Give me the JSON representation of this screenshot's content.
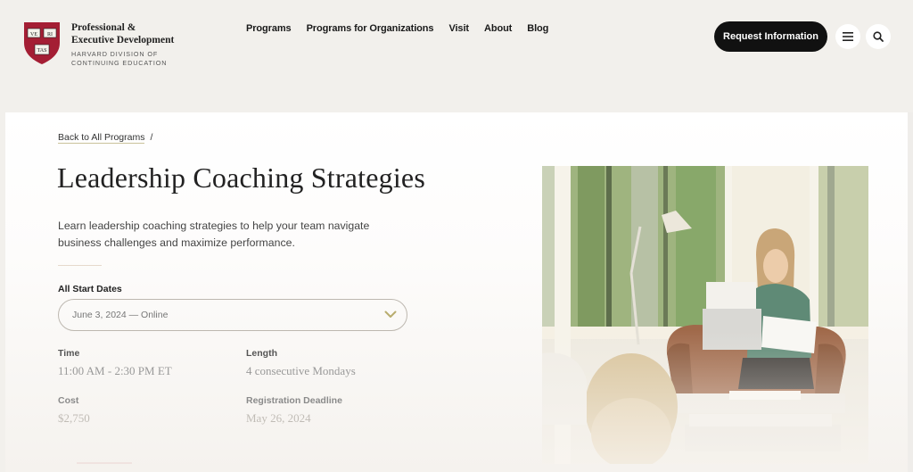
{
  "header": {
    "logo": {
      "title_line1": "Professional &",
      "title_line2": "Executive Development",
      "sub_line1": "HARVARD DIVISION OF",
      "sub_line2": "CONTINUING EDUCATION",
      "shield_color": "#a41e34",
      "shield_words": [
        "VE",
        "RI",
        "TAS"
      ]
    },
    "nav": [
      {
        "label": "Programs"
      },
      {
        "label": "Programs for Organizations"
      },
      {
        "label": "Visit"
      },
      {
        "label": "About"
      },
      {
        "label": "Blog"
      }
    ],
    "cta_label": "Request Information",
    "menu_icon": "hamburger-menu-icon",
    "search_icon": "search-icon"
  },
  "breadcrumb": {
    "back_label": "Back to All Programs",
    "separator": "/"
  },
  "program": {
    "title": "Leadership Coaching Strategies",
    "description": "Learn leadership coaching strategies to help your team navigate business challenges and maximize performance.",
    "start_dates_label": "All Start Dates",
    "selected_date": "June 3, 2024 — Online",
    "details": {
      "time_label": "Time",
      "time_value": "11:00 AM - 2:30 PM ET",
      "length_label": "Length",
      "length_value": "4 consecutive Mondays",
      "cost_label": "Cost",
      "cost_value": "$2,750",
      "deadline_label": "Registration Deadline",
      "deadline_value": "May 26, 2024"
    },
    "image_alt": "Woman with laptop reading papers in armchair by a window, child in foreground"
  },
  "colors": {
    "accent_chevron": "#b8ac6e",
    "cta_bg": "#111111",
    "page_bg": "#f2f0ec"
  }
}
